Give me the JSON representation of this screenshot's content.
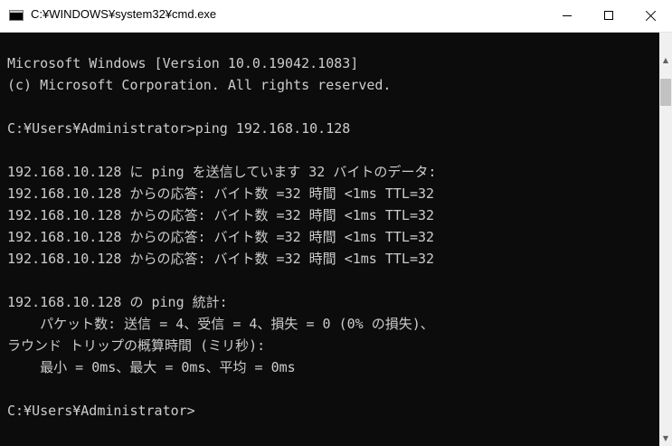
{
  "window": {
    "title": "C:¥WINDOWS¥system32¥cmd.exe",
    "icon": "console-icon",
    "controls": {
      "minimize": "minimize-icon",
      "maximize": "maximize-icon",
      "close": "close-icon"
    }
  },
  "console": {
    "background": "#0c0c0c",
    "foreground": "#cccccc",
    "lines": [
      "Microsoft Windows [Version 10.0.19042.1083]",
      "(c) Microsoft Corporation. All rights reserved.",
      "",
      "C:¥Users¥Administrator>ping 192.168.10.128",
      "",
      "192.168.10.128 に ping を送信しています 32 バイトのデータ:",
      "192.168.10.128 からの応答: バイト数 =32 時間 <1ms TTL=32",
      "192.168.10.128 からの応答: バイト数 =32 時間 <1ms TTL=32",
      "192.168.10.128 からの応答: バイト数 =32 時間 <1ms TTL=32",
      "192.168.10.128 からの応答: バイト数 =32 時間 <1ms TTL=32",
      "",
      "192.168.10.128 の ping 統計:",
      "    パケット数: 送信 = 4、受信 = 4、損失 = 0 (0% の損失)、",
      "ラウンド トリップの概算時間 (ミリ秒):",
      "    最小 = 0ms、最大 = 0ms、平均 = 0ms",
      "",
      "C:¥Users¥Administrator>"
    ]
  },
  "scrollbar": {
    "up_arrow": "▲",
    "down_arrow": "▼"
  }
}
